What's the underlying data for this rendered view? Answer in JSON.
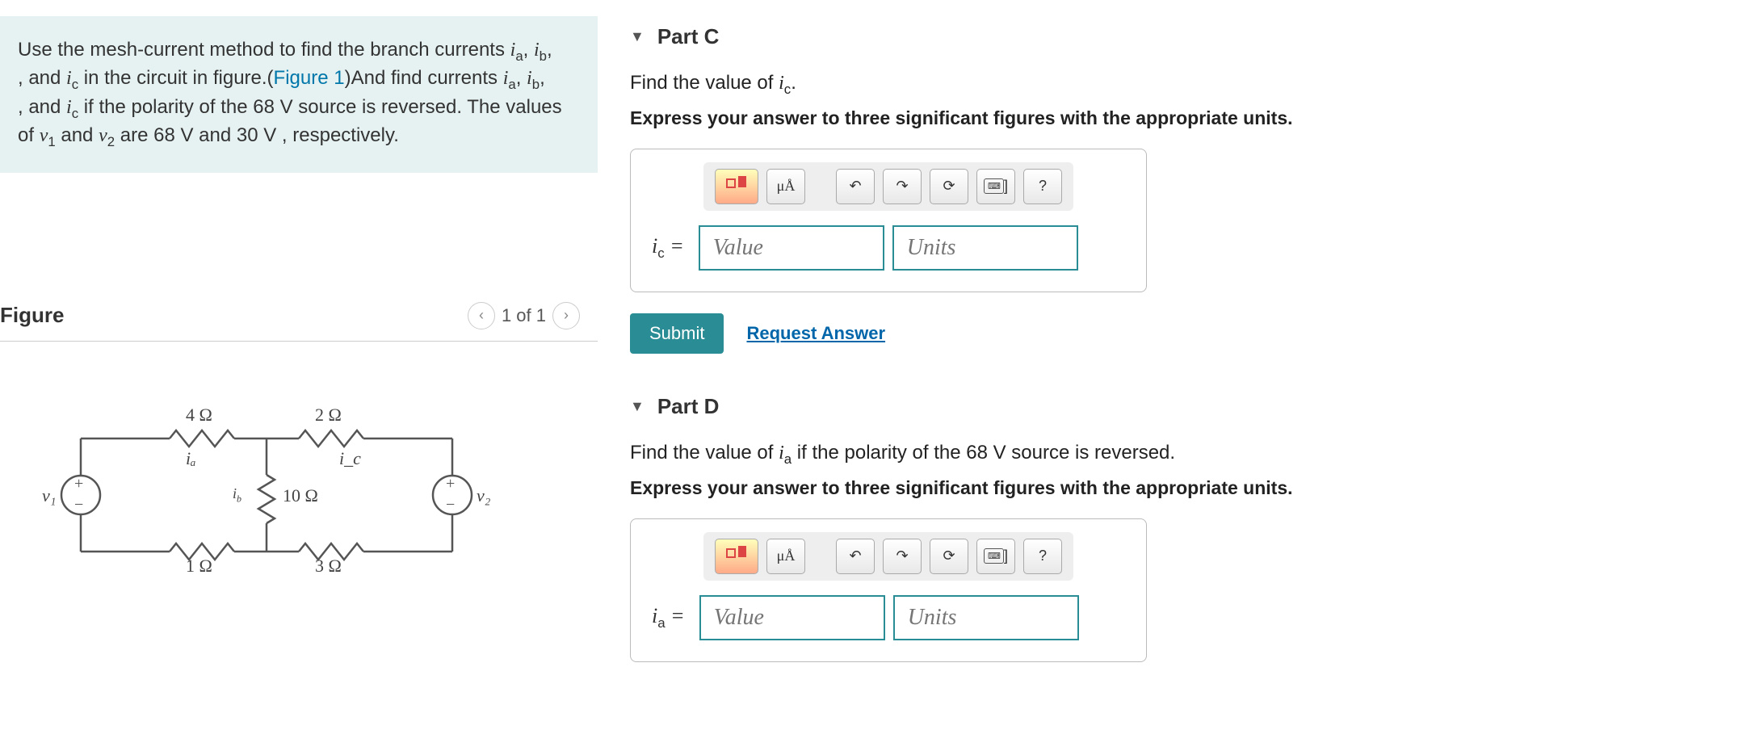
{
  "problem": {
    "text_pre": "Use the mesh-current method to find the branch currents ",
    "i_a": "i",
    "i_a_sub": "a",
    "i_b": "i",
    "i_b_sub": "b",
    "i_c": "i",
    "i_c_sub": "c",
    "text_mid1": ", and ",
    "text_mid2": " in the circuit in figure.(",
    "fig_link": "Figure 1",
    "text_mid3": ")And find currents ",
    "text_mid4": ", and ",
    "text_mid5": " if the polarity of the 68 ",
    "V": "V",
    "text_mid6": " source is reversed. The values of ",
    "v1": "v",
    "v1_sub": "1",
    "text_and": " and ",
    "v2": "v",
    "v2_sub": "2",
    "text_mid7": " are 68 ",
    "text_mid8": " and 30 ",
    "text_end": " , respectively."
  },
  "figure": {
    "title": "Figure",
    "nav": "1 of 1",
    "labels": {
      "r_top_left": "4 Ω",
      "r_top_right": "2 Ω",
      "ia": "iₐ",
      "ib": "i_b",
      "ic": "i_c",
      "r_mid": "10 Ω",
      "r_bot_left": "1 Ω",
      "r_bot_right": "3 Ω",
      "v1": "v₁",
      "v2": "v₂"
    }
  },
  "part_c": {
    "title": "Part C",
    "prompt_pre": "Find the value of ",
    "prompt_var": "i",
    "prompt_sub": "c",
    "prompt_post": ".",
    "instruction": "Express your answer to three significant figures with the appropriate units.",
    "eq_var": "i",
    "eq_sub": "c",
    "eq_sign": " = ",
    "value_ph": "Value",
    "units_ph": "Units",
    "toolbar": {
      "unit_btn": "μÅ",
      "help": "?"
    },
    "submit": "Submit",
    "request": "Request Answer"
  },
  "part_d": {
    "title": "Part D",
    "prompt_pre": "Find the value of ",
    "prompt_var": "i",
    "prompt_sub": "a",
    "prompt_mid": " if the polarity of the 68 ",
    "prompt_V": "V",
    "prompt_post": " source is reversed.",
    "instruction": "Express your answer to three significant figures with the appropriate units.",
    "eq_var": "i",
    "eq_sub": "a",
    "eq_sign": " = ",
    "value_ph": "Value",
    "units_ph": "Units",
    "toolbar": {
      "unit_btn": "μÅ",
      "help": "?"
    }
  }
}
